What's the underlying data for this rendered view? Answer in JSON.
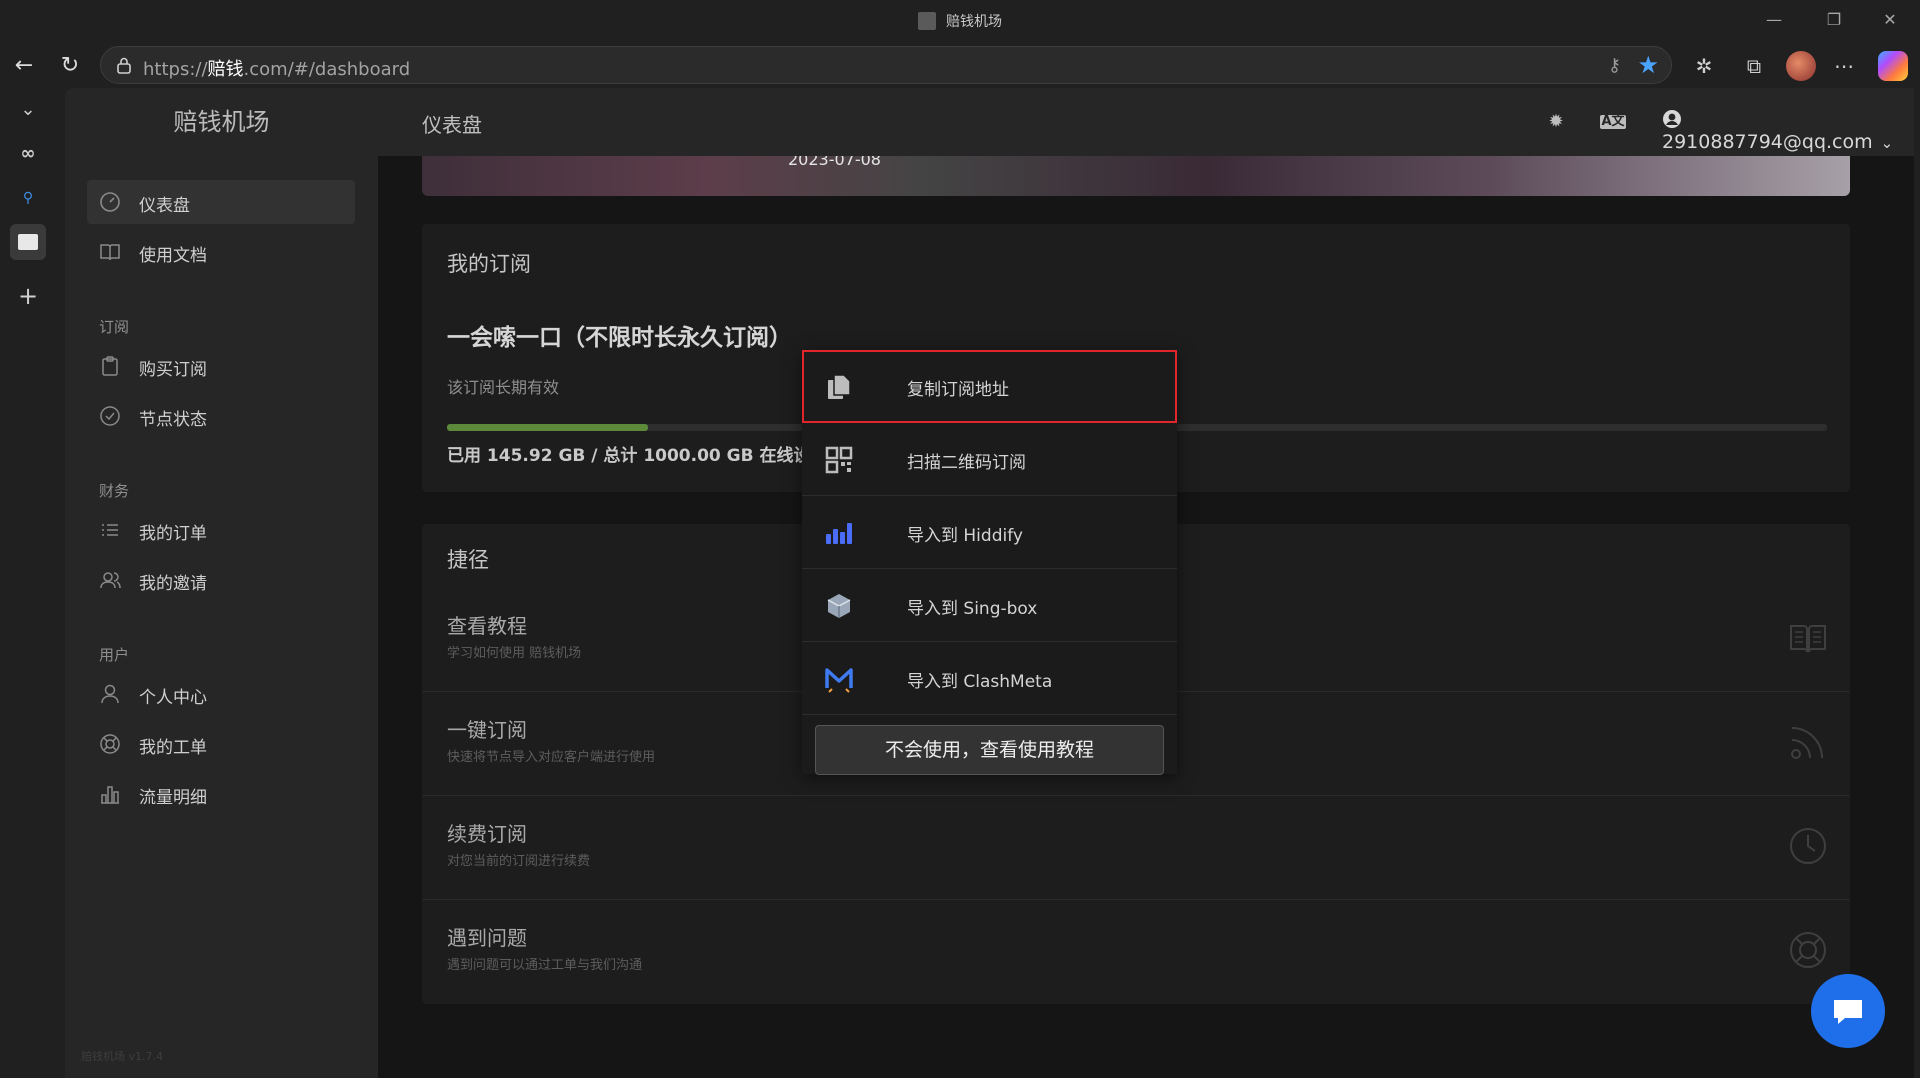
{
  "window": {
    "title": "赔钱机场"
  },
  "browser": {
    "url_prefix": "https://",
    "url_host": "赔钱",
    "url_rest": ".com/#/dashboard"
  },
  "sidebar": {
    "brand": "赔钱机场",
    "items": [
      {
        "label": "仪表盘",
        "icon": "dashboard-icon",
        "active": true
      },
      {
        "label": "使用文档",
        "icon": "book-icon"
      }
    ],
    "groups": [
      {
        "label": "订阅",
        "items": [
          {
            "label": "购买订阅",
            "icon": "clipboard-icon"
          },
          {
            "label": "节点状态",
            "icon": "check-circle-icon"
          }
        ]
      },
      {
        "label": "财务",
        "items": [
          {
            "label": "我的订单",
            "icon": "list-icon"
          },
          {
            "label": "我的邀请",
            "icon": "users-icon"
          }
        ]
      },
      {
        "label": "用户",
        "items": [
          {
            "label": "个人中心",
            "icon": "user-icon"
          },
          {
            "label": "我的工单",
            "icon": "lifebuoy-icon"
          },
          {
            "label": "流量明细",
            "icon": "bar-chart-icon"
          }
        ]
      }
    ],
    "version": "赔钱机场 v1.7.4"
  },
  "topbar": {
    "title": "仪表盘",
    "user_email": "2910887794@qq.com"
  },
  "banner": {
    "date": "2023-07-08"
  },
  "subscription": {
    "card_title": "我的订阅",
    "plan_name": "一会嗦一口（不限时长永久订阅）",
    "validity": "该订阅长期有效",
    "used_fraction": 0.1459,
    "usage_text": "已用 145.92 GB / 总计 1000.00 GB 在线设备"
  },
  "shortcuts": {
    "card_title": "捷径",
    "items": [
      {
        "title": "查看教程",
        "subtitle": "学习如何使用 赔钱机场",
        "icon": "book-icon"
      },
      {
        "title": "一键订阅",
        "subtitle": "快速将节点导入对应客户端进行使用",
        "icon": "rss-icon"
      },
      {
        "title": "续费订阅",
        "subtitle": "对您当前的订阅进行续费",
        "icon": "clock-icon"
      },
      {
        "title": "遇到问题",
        "subtitle": "遇到问题可以通过工单与我们沟通",
        "icon": "lifebuoy-icon"
      }
    ]
  },
  "subscribe_menu": {
    "items": [
      {
        "label": "复制订阅地址",
        "icon": "copy-icon",
        "selected": true
      },
      {
        "label": "扫描二维码订阅",
        "icon": "qrcode-icon"
      },
      {
        "label": "导入到 Hiddify",
        "icon": "hiddify-icon"
      },
      {
        "label": "导入到 Sing-box",
        "icon": "singbox-icon"
      },
      {
        "label": "导入到 ClashMeta",
        "icon": "clashmeta-icon"
      }
    ],
    "help_button": "不会使用，查看使用教程"
  },
  "colors": {
    "accent": "#1f6feb",
    "selection_outline": "#e0262b",
    "progress": "#5d8a3a"
  }
}
